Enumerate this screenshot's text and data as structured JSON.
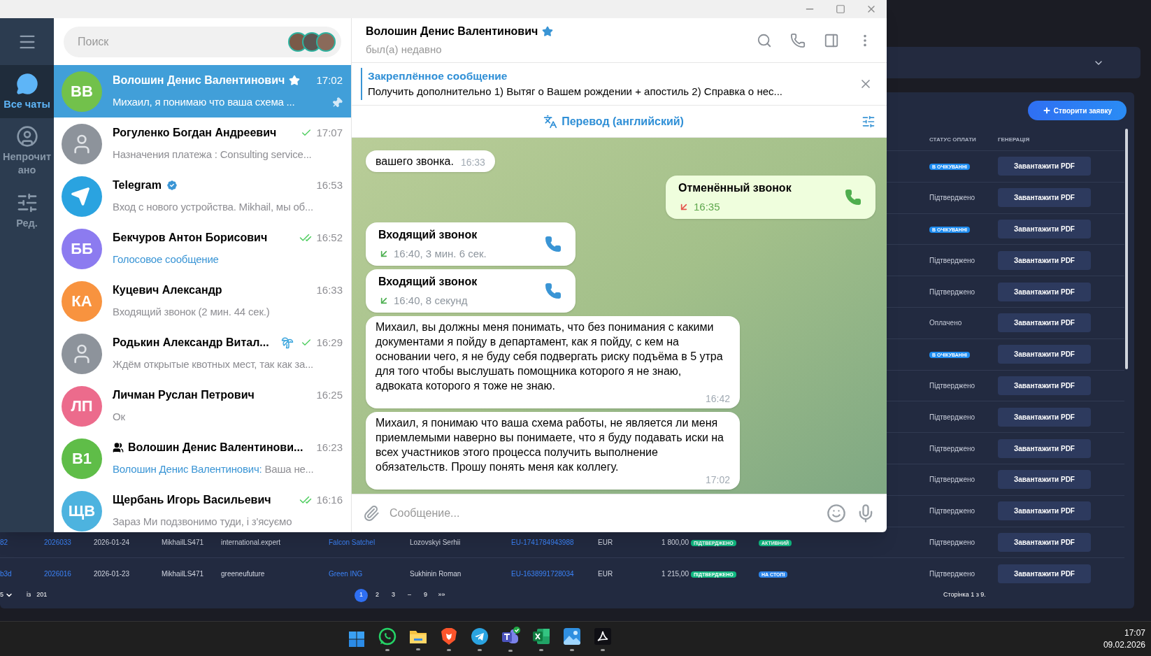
{
  "web_app": {
    "create_button": "Створити заявку",
    "columns": [
      "СТАТУС ОПЛАТИ",
      "ГЕНЕРАЦІЯ"
    ],
    "rows": [
      {
        "status": {
          "kind": "badge",
          "text": "В ОЧІКУВАННІ",
          "color": "#1d8cf0"
        },
        "action": "Завантажити PDF"
      },
      {
        "status": {
          "kind": "text",
          "text": "Підтверджено"
        },
        "action": "Завантажити PDF"
      },
      {
        "status": {
          "kind": "badge",
          "text": "В ОЧІКУВАННІ",
          "color": "#1d8cf0"
        },
        "action": "Завантажити PDF"
      },
      {
        "status": {
          "kind": "text",
          "text": "Підтверджено"
        },
        "action": "Завантажити PDF"
      },
      {
        "status": {
          "kind": "text",
          "text": "Підтверджено"
        },
        "action": "Завантажити PDF"
      },
      {
        "status": {
          "kind": "text",
          "text": "Оплачено"
        },
        "action": "Завантажити PDF"
      },
      {
        "status": {
          "kind": "badge",
          "text": "В ОЧІКУВАННІ",
          "color": "#1d8cf0"
        },
        "action": "Завантажити PDF"
      },
      {
        "status": {
          "kind": "text",
          "text": "Підтверджено"
        },
        "action": "Завантажити PDF"
      },
      {
        "status": {
          "kind": "text",
          "text": "Підтверджено"
        },
        "action": "Завантажити PDF"
      },
      {
        "status": {
          "kind": "text",
          "text": "Підтверджено"
        },
        "action": "Завантажити PDF"
      },
      {
        "status": {
          "kind": "text",
          "text": "Підтверджено"
        },
        "action": "Завантажити PDF"
      },
      {
        "status": {
          "kind": "text",
          "text": "Підтверджено"
        },
        "action": "Завантажити PDF"
      }
    ],
    "full_rows": [
      {
        "cells": [
          {
            "kind": "link",
            "text": "82"
          },
          {
            "kind": "link",
            "text": "2026033"
          },
          {
            "kind": "text",
            "text": "2026-01-24"
          },
          {
            "kind": "text",
            "text": "MikhailLS471"
          },
          {
            "kind": "text",
            "text": "international.expert"
          },
          {
            "kind": "link",
            "text": "Falcon Satchel"
          },
          {
            "kind": "text",
            "text": "Lozovskyi Serhii"
          },
          {
            "kind": "link",
            "text": "EU-1741784943988"
          },
          {
            "kind": "text",
            "text": "EUR"
          }
        ],
        "amount": "1 800,00",
        "badges": [
          {
            "text": "ПІДТВЕРДЖЕНО",
            "color": "#10b981"
          },
          {
            "text": "АКТИВНИЙ",
            "color": "#10b981"
          }
        ],
        "status": "Підтверджено",
        "action": "Завантажити PDF"
      },
      {
        "cells": [
          {
            "kind": "link",
            "text": "b3d"
          },
          {
            "kind": "link",
            "text": "2026016"
          },
          {
            "kind": "text",
            "text": "2026-01-23"
          },
          {
            "kind": "text",
            "text": "MikhailLS471"
          },
          {
            "kind": "text",
            "text": "greeneufuture"
          },
          {
            "kind": "link",
            "text": "Green ING"
          },
          {
            "kind": "text",
            "text": "Sukhinin Roman"
          },
          {
            "kind": "link",
            "text": "EU-1638991728034"
          },
          {
            "kind": "text",
            "text": "EUR"
          }
        ],
        "amount": "1 215,00",
        "badges": [
          {
            "text": "ПІДТВЕРДЖЕНО",
            "color": "#10b981"
          },
          {
            "text": "НА СТОПІ",
            "color": "#2b84ea"
          }
        ],
        "status": "Підтверджено",
        "action": "Завантажити PDF"
      }
    ],
    "pagination": {
      "page_size": "5",
      "of_label": "із",
      "total": "201",
      "pages": [
        {
          "label": "1",
          "selected": true
        },
        {
          "label": "2",
          "selected": false
        },
        {
          "label": "3",
          "selected": false
        },
        {
          "label": "–",
          "selected": false
        },
        {
          "label": "9",
          "selected": false
        },
        {
          "label": "»»",
          "selected": false
        }
      ],
      "page_info": "Сторінка 1 з 9."
    }
  },
  "telegram": {
    "rail": [
      {
        "kind": "chats",
        "label": "Все чаты",
        "selected": true
      },
      {
        "kind": "unread",
        "label": "Непрочитано",
        "selected": false
      },
      {
        "kind": "edit",
        "label": "Ред.",
        "selected": false
      }
    ],
    "search": {
      "placeholder": "Поиск"
    },
    "chats": [
      {
        "avatar": {
          "kind": "initials",
          "text": "ВВ",
          "color": "#72c14b"
        },
        "name": "Волошин Денис Валентинович",
        "name_icon": {
          "kind": "star"
        },
        "time": "17:02",
        "media_preview": false,
        "preview": "Михаил, я понимаю что ваша схема ...",
        "trailing_icon": {
          "kind": "pin"
        },
        "selected": true
      },
      {
        "avatar": {
          "kind": "photo"
        },
        "name": "Рогуленко Богдан Андреевич",
        "ticks": {
          "kind": "single"
        },
        "time": "17:07",
        "media_preview": false,
        "preview": "Назначения платежа : Consulting service...",
        "selected": false
      },
      {
        "avatar": {
          "kind": "logo"
        },
        "name": "Telegram",
        "name_icon": {
          "kind": "verified"
        },
        "time": "16:53",
        "media_preview": false,
        "preview": "Вход с нового устройства. Mikhail, мы об...",
        "selected": false
      },
      {
        "avatar": {
          "kind": "initials",
          "text": "ББ",
          "color": "#8c7bf0"
        },
        "name": "Бекчуров Антон Борисович",
        "ticks": {
          "kind": "double"
        },
        "time": "16:52",
        "media_preview": true,
        "preview": "Голосовое сообщение",
        "selected": false
      },
      {
        "avatar": {
          "kind": "initials",
          "text": "КА",
          "color": "#f8933f"
        },
        "name": "Куцевич Александр",
        "time": "16:33",
        "media_preview": false,
        "preview": "Входящий звонок (2 мин. 44 сек.)",
        "selected": false
      },
      {
        "avatar": {
          "kind": "photo"
        },
        "name": "Родькин Александр Витал...",
        "status_icon": {
          "kind": "palm"
        },
        "ticks": {
          "kind": "single"
        },
        "time": "16:29",
        "media_preview": false,
        "preview": "Ждём открытые квотных мест, так как за...",
        "selected": false
      },
      {
        "avatar": {
          "kind": "initials",
          "text": "ЛП",
          "color": "#ec6b8c"
        },
        "name": "Личман Руслан Петрович",
        "time": "16:25",
        "media_preview": false,
        "preview": "Ок",
        "selected": false
      },
      {
        "avatar": {
          "kind": "initials",
          "text": "В1",
          "color": "#5fbd48"
        },
        "lead_icon": {
          "kind": "group"
        },
        "name": "Волошин Денис Валентинови...",
        "time": "16:23",
        "media_preview": false,
        "sender": "Волошин Денис Валентинович:",
        "preview": "Ваша не...",
        "selected": false
      },
      {
        "avatar": {
          "kind": "initials",
          "text": "ЩВ",
          "color": "#4db3df"
        },
        "name": "Щербань Игорь Васильевич",
        "ticks": {
          "kind": "double"
        },
        "time": "16:16",
        "media_preview": false,
        "preview": "Зараз Ми подзвонимо туди, і з'ясуємо",
        "selected": false
      }
    ],
    "header": {
      "name": "Волошин Денис Валентинович",
      "starred": true,
      "status": "был(а) недавно"
    },
    "pinned": {
      "title": "Закреплённое сообщение",
      "text": "Получить дополнительно  1) Вытяг о Вашем рождении + апостиль 2) Справка о нес..."
    },
    "translate": {
      "label": "Перевод (английский)"
    },
    "messages": [
      {
        "kind": "text",
        "outgoing": false,
        "text": "вашего звонка.",
        "time": "16:33"
      },
      {
        "kind": "call",
        "outgoing": true,
        "title": "Отменённый звонок",
        "cancelled": true,
        "detail": "16:35"
      },
      {
        "kind": "call",
        "outgoing": false,
        "title": "Входящий звонок",
        "cancelled": false,
        "detail": "16:40, 3 мин. 6 сек."
      },
      {
        "kind": "call",
        "outgoing": false,
        "title": "Входящий звонок",
        "cancelled": false,
        "detail": "16:40, 8 секунд"
      },
      {
        "kind": "text",
        "outgoing": false,
        "text": "Михаил, вы должны меня понимать, что без понимания с какими документами я пойду в департамент, как я пойду, с кем на основании чего, я не буду себя подвергать риску подъёма в 5 утра для того чтобы выслушать помощника которого я не знаю, адвоката которого я тоже не знаю.",
        "time": "16:42"
      },
      {
        "kind": "text",
        "outgoing": false,
        "text": "Михаил, я понимаю что ваша схема работы, не является ли меня приемлемыми наверно вы понимаете, что я буду подавать иски на всех участников этого процесса получить выполнение обязательств. Прошу понять меня как коллегу.",
        "time": "17:02"
      }
    ],
    "composer": {
      "placeholder": "Сообщение..."
    }
  },
  "taskbar": {
    "apps": [
      {
        "kind": "start",
        "running": false
      },
      {
        "kind": "whatsapp",
        "running": true
      },
      {
        "kind": "explorer",
        "running": true
      },
      {
        "kind": "brave",
        "running": true
      },
      {
        "kind": "telegram",
        "running": true
      },
      {
        "kind": "teams",
        "running": true
      },
      {
        "kind": "excel",
        "running": true
      },
      {
        "kind": "photos",
        "running": true
      },
      {
        "kind": "acrobat",
        "running": true
      }
    ],
    "time": "17:07",
    "date": "09.02.2026"
  }
}
